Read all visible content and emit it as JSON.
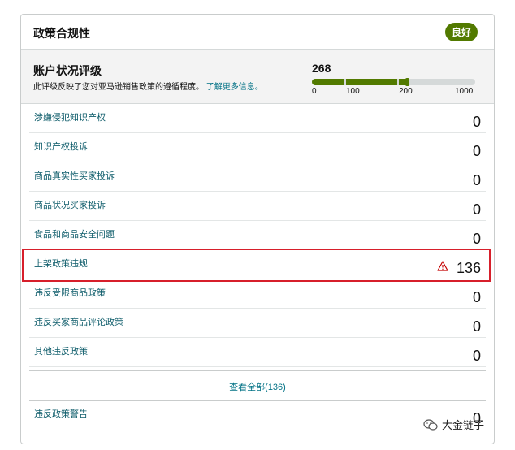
{
  "header": {
    "title": "政策合规性",
    "badge": "良好"
  },
  "rating": {
    "title": "账户状况评级",
    "description": "此评级反映了您对亚马逊销售政策的遵循程度。",
    "link": "了解更多信息。",
    "score": "268",
    "score_value": 268,
    "ticks": [
      "0",
      "100",
      "200",
      "1000"
    ],
    "bar_color": "#527a00"
  },
  "rows": [
    {
      "label": "涉嫌侵犯知识产权",
      "value": "0"
    },
    {
      "label": "知识产权投诉",
      "value": "0"
    },
    {
      "label": "商品真实性买家投诉",
      "value": "0"
    },
    {
      "label": "商品状况买家投诉",
      "value": "0"
    },
    {
      "label": "食品和商品安全问题",
      "value": "0"
    },
    {
      "label": "上架政策违规",
      "value": "136",
      "icon": "warning-icon"
    },
    {
      "label": "违反受限商品政策",
      "value": "0"
    },
    {
      "label": "违反买家商品评论政策",
      "value": "0"
    },
    {
      "label": "其他违反政策",
      "value": "0"
    }
  ],
  "view_all": "查看全部(136)",
  "policy_warning": {
    "label": "违反政策警告",
    "value": "0"
  },
  "watermark": "大金链子",
  "colors": {
    "highlight": "#d71f2b",
    "link": "#007185",
    "good": "#527a00"
  }
}
